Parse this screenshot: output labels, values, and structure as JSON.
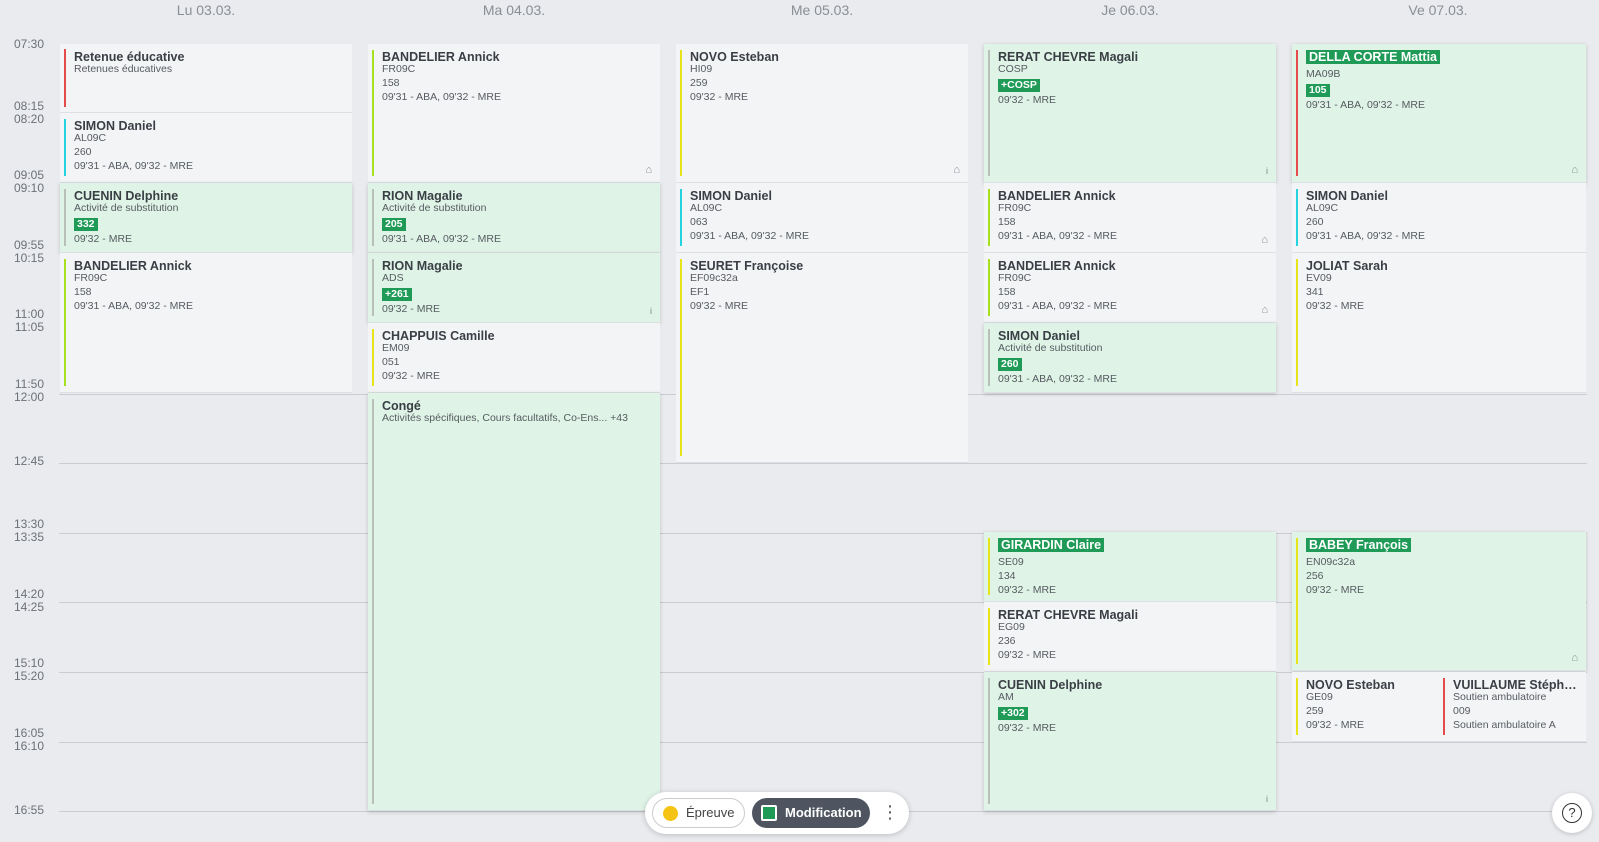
{
  "days": [
    "Lu 03.03.",
    "Ma 04.03.",
    "Me 05.03.",
    "Je 06.03.",
    "Ve 07.03."
  ],
  "times": [
    "07:30",
    "08:15",
    "08:20",
    "09:05",
    "09:10",
    "09:55",
    "10:15",
    "11:00",
    "11:05",
    "11:50",
    "12:00",
    "12:45",
    "13:30",
    "13:35",
    "14:20",
    "14:25",
    "15:10",
    "15:20",
    "16:05",
    "16:10",
    "16:55"
  ],
  "colors": {
    "green_badge": "#1f9b57",
    "green_card": "#dff4e7",
    "grey_card": "#f3f4f6",
    "bar_yellow": "#e8e41a",
    "bar_cyan": "#26d1e0",
    "bar_red": "#e54b4b",
    "bar_lime": "#a6e01e",
    "bar_grey": "#b9c0b9"
  },
  "events": {
    "mon1": {
      "title": "Retenue éducative",
      "sub": "Retenues éducatives"
    },
    "mon2": {
      "title": "SIMON Daniel",
      "sub": "AL09C",
      "room": "260",
      "time": "09'31 - ABA, 09'32 - MRE"
    },
    "mon3": {
      "title": "CUENIN Delphine",
      "sub": "Activité de substitution",
      "room": "332",
      "time": "09'32 - MRE"
    },
    "mon4": {
      "title": "BANDELIER Annick",
      "sub": "FR09C",
      "room": "158",
      "time": "09'31 - ABA, 09'32 - MRE"
    },
    "tue1": {
      "title": "BANDELIER Annick",
      "sub": "FR09C",
      "room": "158",
      "time": "09'31 - ABA, 09'32 - MRE",
      "icon": "house-icon"
    },
    "tue2": {
      "title": "RION Magalie",
      "sub": "Activité de substitution",
      "room": "205",
      "time": "09'31 - ABA, 09'32 - MRE"
    },
    "tue3": {
      "title": "RION Magalie",
      "sub": "ADS",
      "room": "+261",
      "time": "09'32 - MRE",
      "icon": "info-icon"
    },
    "tue4": {
      "title": "CHAPPUIS Camille",
      "sub": "EM09",
      "room": "051",
      "time": "09'32 - MRE"
    },
    "tue5": {
      "title": "Congé",
      "sub": "Activités spécifiques, Cours facultatifs, Co-Ens... +43"
    },
    "wed1": {
      "title": "NOVO Esteban",
      "sub": "HI09",
      "room": "259",
      "time": "09'32 - MRE",
      "icon": "house-icon"
    },
    "wed2": {
      "title": "SIMON Daniel",
      "sub": "AL09C",
      "room": "063",
      "time": "09'31 - ABA, 09'32 - MRE"
    },
    "wed3": {
      "title": "SEURET Françoise",
      "sub": "EF09c32a",
      "room": "EF1",
      "time": "09'32 - MRE"
    },
    "thu1": {
      "title": "RERAT CHEVRE Magali",
      "sub": "COSP",
      "room": "+COSP",
      "time": "09'32 - MRE",
      "icon": "info-icon"
    },
    "thu2": {
      "title": "BANDELIER Annick",
      "sub": "FR09C",
      "room": "158",
      "time": "09'31 - ABA, 09'32 - MRE",
      "icon": "house-icon"
    },
    "thu3": {
      "title": "BANDELIER Annick",
      "sub": "FR09C",
      "room": "158",
      "time": "09'31 - ABA, 09'32 - MRE",
      "icon": "house-icon"
    },
    "thu4": {
      "title": "SIMON Daniel",
      "sub": "Activité de substitution",
      "room": "260",
      "time": "09'31 - ABA, 09'32 - MRE"
    },
    "thu5": {
      "title": "GIRARDIN Claire",
      "sub": "SE09",
      "room": "134",
      "time": "09'32 - MRE"
    },
    "thu6": {
      "title": "RERAT CHEVRE Magali",
      "sub": "EG09",
      "room": "236",
      "time": "09'32 - MRE"
    },
    "thu7": {
      "title": "CUENIN Delphine",
      "sub": "AM",
      "room": "+302",
      "time": "09'32 - MRE",
      "icon": "info-icon"
    },
    "fri1": {
      "title": "DELLA CORTE Mattia",
      "sub": "MA09B",
      "room": "105",
      "time": "09'31 - ABA, 09'32 - MRE",
      "icon": "house-icon"
    },
    "fri2": {
      "title": "SIMON Daniel",
      "sub": "AL09C",
      "room": "260",
      "time": "09'31 - ABA, 09'32 - MRE"
    },
    "fri3": {
      "title": "JOLIAT Sarah",
      "sub": "EV09",
      "room": "341",
      "time": "09'32 - MRE"
    },
    "fri4": {
      "title": "BABEY François",
      "sub": "EN09c32a",
      "room": "256",
      "time": "09'32 - MRE",
      "icon": "house-icon"
    },
    "fri5": {
      "title": "NOVO Esteban",
      "sub": "GE09",
      "room": "259",
      "time": "09'32 - MRE"
    },
    "fri6": {
      "title": "VUILLAUME Stépha...",
      "sub": "Soutien ambulatoire",
      "room": "009",
      "time": "Soutien ambulatoire A"
    }
  },
  "toolbar": {
    "epreuve_label": "Épreuve",
    "modification_label": "Modification",
    "more_icon": "⋮"
  },
  "help": {
    "label": "?"
  }
}
